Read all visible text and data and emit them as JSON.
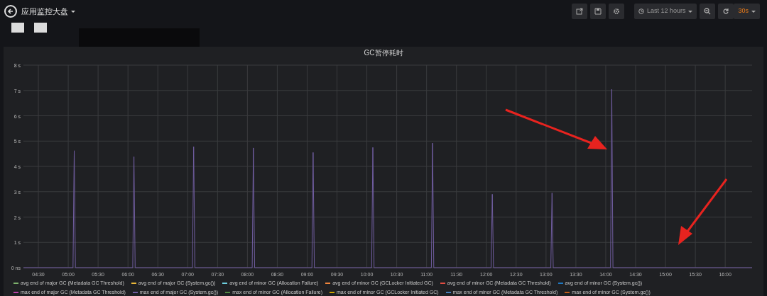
{
  "header": {
    "title": "应用监控大盘",
    "time_range": "Last 12 hours",
    "refresh_interval": "30s"
  },
  "panel": {
    "title": "GC暂停耗时",
    "chart_data": {
      "type": "line",
      "grid": true,
      "ylim": [
        0,
        8
      ],
      "xlim": [
        4.25,
        16.45
      ],
      "yticks": [
        {
          "value": 0,
          "label": "0 ns"
        },
        {
          "value": 1,
          "label": "1 s"
        },
        {
          "value": 2,
          "label": "2 s"
        },
        {
          "value": 3,
          "label": "3 s"
        },
        {
          "value": 4,
          "label": "4 s"
        },
        {
          "value": 5,
          "label": "5 s"
        },
        {
          "value": 6,
          "label": "6 s"
        },
        {
          "value": 7,
          "label": "7 s"
        },
        {
          "value": 8,
          "label": "8 s"
        }
      ],
      "xticks": [
        {
          "value": 4.5,
          "label": "04:30"
        },
        {
          "value": 5,
          "label": "05:00"
        },
        {
          "value": 5.5,
          "label": "05:30"
        },
        {
          "value": 6,
          "label": "06:00"
        },
        {
          "value": 6.5,
          "label": "06:30"
        },
        {
          "value": 7,
          "label": "07:00"
        },
        {
          "value": 7.5,
          "label": "07:30"
        },
        {
          "value": 8,
          "label": "08:00"
        },
        {
          "value": 8.5,
          "label": "08:30"
        },
        {
          "value": 9,
          "label": "09:00"
        },
        {
          "value": 9.5,
          "label": "09:30"
        },
        {
          "value": 10,
          "label": "10:00"
        },
        {
          "value": 10.5,
          "label": "10:30"
        },
        {
          "value": 11,
          "label": "11:00"
        },
        {
          "value": 11.5,
          "label": "11:30"
        },
        {
          "value": 12,
          "label": "12:00"
        },
        {
          "value": 12.5,
          "label": "12:30"
        },
        {
          "value": 13,
          "label": "13:00"
        },
        {
          "value": 13.5,
          "label": "13:30"
        },
        {
          "value": 14,
          "label": "14:00"
        },
        {
          "value": 14.5,
          "label": "14:30"
        },
        {
          "value": 15,
          "label": "15:00"
        },
        {
          "value": 15.5,
          "label": "15:30"
        },
        {
          "value": 16,
          "label": "16:00"
        }
      ],
      "x": [
        4.25,
        5.08,
        5.1,
        5.12,
        6.08,
        6.1,
        6.12,
        7.08,
        7.1,
        7.12,
        8.08,
        8.1,
        8.12,
        9.08,
        9.1,
        9.12,
        10.08,
        10.1,
        10.12,
        11.08,
        11.1,
        11.12,
        12.08,
        12.1,
        12.12,
        13.08,
        13.1,
        13.12,
        14.08,
        14.1,
        14.12,
        16.45
      ],
      "series": [
        {
          "name": "avg end of major GC (Metadata GC Threshold)",
          "color": "#7eb26d",
          "values": [
            null,
            null,
            null,
            null,
            null,
            null,
            null,
            null,
            null,
            null,
            null,
            null,
            null,
            null,
            null,
            null,
            null,
            null,
            null,
            null,
            null,
            null,
            null,
            null,
            null,
            null,
            null,
            null,
            null,
            null,
            null,
            null
          ]
        },
        {
          "name": "avg end of major GC (System.gc())",
          "color": "#eab839",
          "values": [
            null,
            null,
            null,
            null,
            null,
            null,
            null,
            null,
            null,
            null,
            null,
            null,
            null,
            null,
            null,
            null,
            null,
            null,
            null,
            null,
            null,
            null,
            null,
            null,
            null,
            null,
            null,
            null,
            null,
            null,
            null,
            null
          ]
        },
        {
          "name": "avg end of minor GC (Allocation Failure)",
          "color": "#6ed0e0",
          "values": [
            null,
            null,
            null,
            null,
            null,
            null,
            null,
            null,
            null,
            null,
            null,
            null,
            null,
            null,
            null,
            null,
            null,
            null,
            null,
            null,
            null,
            null,
            null,
            null,
            null,
            null,
            null,
            null,
            null,
            null,
            null,
            null
          ]
        },
        {
          "name": "avg end of minor GC (GCLocker Initiated GC)",
          "color": "#ef843c",
          "values": [
            null,
            null,
            null,
            null,
            null,
            null,
            null,
            null,
            null,
            null,
            null,
            null,
            null,
            null,
            null,
            null,
            null,
            null,
            null,
            null,
            null,
            null,
            null,
            null,
            null,
            null,
            null,
            null,
            null,
            null,
            null,
            null
          ]
        },
        {
          "name": "avg end of minor GC (Metadata GC Threshold)",
          "color": "#e24d42",
          "values": [
            null,
            null,
            null,
            null,
            null,
            null,
            null,
            null,
            null,
            null,
            null,
            null,
            null,
            null,
            null,
            null,
            null,
            null,
            null,
            null,
            null,
            null,
            null,
            null,
            null,
            null,
            null,
            null,
            null,
            null,
            null,
            null
          ]
        },
        {
          "name": "avg end of minor GC (System.gc())",
          "color": "#1f78c1",
          "values": [
            null,
            null,
            null,
            null,
            null,
            null,
            null,
            null,
            null,
            null,
            null,
            null,
            null,
            null,
            null,
            null,
            null,
            null,
            null,
            null,
            null,
            null,
            null,
            null,
            null,
            null,
            null,
            null,
            null,
            null,
            null,
            null
          ]
        },
        {
          "name": "max end of major GC (Metadata GC Threshold)",
          "color": "#ba43a9",
          "values": [
            null,
            null,
            null,
            null,
            null,
            null,
            null,
            null,
            null,
            null,
            null,
            null,
            null,
            null,
            null,
            null,
            null,
            null,
            null,
            null,
            null,
            null,
            null,
            null,
            null,
            null,
            null,
            null,
            null,
            null,
            null,
            null
          ]
        },
        {
          "name": "max end of major GC (System.gc())",
          "color": "#705da0",
          "values": [
            0,
            0,
            4.62,
            0,
            0,
            4.38,
            0,
            0,
            4.78,
            0,
            0,
            4.73,
            0,
            0,
            4.55,
            0,
            0,
            4.75,
            0,
            0,
            4.92,
            0,
            0,
            2.9,
            0,
            0,
            2.95,
            0,
            0,
            7.05,
            0,
            0
          ]
        },
        {
          "name": "max end of minor GC (Allocation Failure)",
          "color": "#508642",
          "values": [
            null,
            null,
            null,
            null,
            null,
            null,
            null,
            null,
            null,
            null,
            null,
            null,
            null,
            null,
            null,
            null,
            null,
            null,
            null,
            null,
            null,
            null,
            null,
            null,
            null,
            null,
            null,
            null,
            null,
            null,
            null,
            null
          ]
        },
        {
          "name": "max end of minor GC (GCLocker Initiated GC)",
          "color": "#cca300",
          "values": [
            null,
            null,
            null,
            null,
            null,
            null,
            null,
            null,
            null,
            null,
            null,
            null,
            null,
            null,
            null,
            null,
            null,
            null,
            null,
            null,
            null,
            null,
            null,
            null,
            null,
            null,
            null,
            null,
            null,
            null,
            null,
            null
          ]
        },
        {
          "name": "max end of minor GC (Metadata GC Threshold)",
          "color": "#447ebc",
          "values": [
            null,
            null,
            null,
            null,
            null,
            null,
            null,
            null,
            null,
            null,
            null,
            null,
            null,
            null,
            null,
            null,
            null,
            null,
            null,
            null,
            null,
            null,
            null,
            null,
            null,
            null,
            null,
            null,
            null,
            null,
            null,
            null
          ]
        },
        {
          "name": "max end of minor GC (System.gc())",
          "color": "#c15c17",
          "values": [
            null,
            null,
            null,
            null,
            null,
            null,
            null,
            null,
            null,
            null,
            null,
            null,
            null,
            null,
            null,
            null,
            null,
            null,
            null,
            null,
            null,
            null,
            null,
            null,
            null,
            null,
            null,
            null,
            null,
            null,
            null,
            null
          ]
        }
      ]
    }
  }
}
